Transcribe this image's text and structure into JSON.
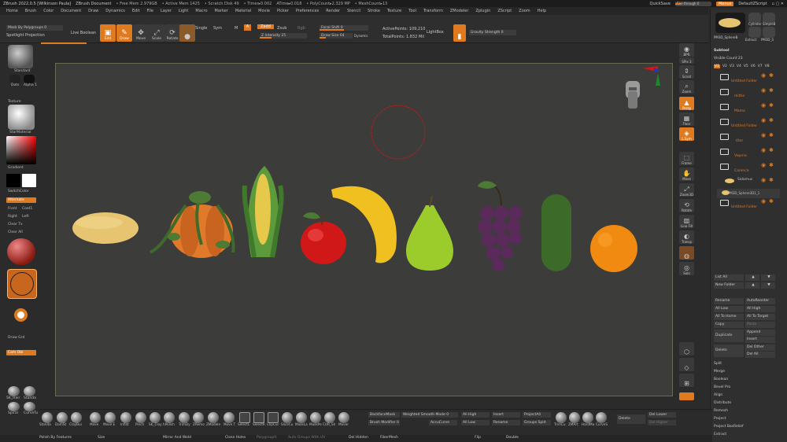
{
  "titlebar": {
    "app_title": "ZBrush 2022.0.5 [Wilkinson Paula]",
    "document": "ZBrush Document",
    "stats": [
      "• Free Mem 2.979GB",
      "• Active Mem 1425",
      "• Scratch Disk 49",
      "• Timer▸0.002",
      "ATime▸0.018",
      "• PolyCount▸2.329 MP",
      "• MeshCount▸13"
    ],
    "quicksave": "QuickSave",
    "see_through": "See-through 0",
    "menus": "Menus",
    "script": "DefaultZScript"
  },
  "menu": [
    "Home",
    "Brush",
    "Color",
    "Document",
    "Draw",
    "Dynamics",
    "Edit",
    "File",
    "Layer",
    "Light",
    "Macro",
    "Marker",
    "Material",
    "Movie",
    "Picker",
    "Preferences",
    "Render",
    "Stencil",
    "Stroke",
    "Texture",
    "Tool",
    "Transform",
    "ZModeler",
    "Zplugin",
    "ZScript",
    "Zoom",
    "Help"
  ],
  "toolbar": {
    "mask_by_polygroups": "Mask By Polygroups 0",
    "spotlight_projection": "Spotlight Projection",
    "live_boolean": "Live Boolean",
    "edit": "Edit",
    "draw": "Draw",
    "move": "Move",
    "scale": "Scale",
    "rotate": "Rotate",
    "single": "Single",
    "sym": "Sym",
    "m": "M",
    "zadd": "Zadd",
    "zsub": "Zsub",
    "rgb": "Rgb",
    "z_intensity": "Z Intensity 25",
    "focal_shift": "Focal Shift 0",
    "draw_size": "Draw Size 64",
    "dynamic": "Dynamic",
    "active_points": "ActivePoints: 109,210",
    "total_points": "TotalPoints: 1.832 Mil",
    "lightbox": "LightBox",
    "gravity_strength": "Gravity Strength 0"
  },
  "leftshelf": {
    "standard": "Standard",
    "dots": "Dots",
    "alpha": "Alpha 1",
    "texture": "Texture",
    "starmaterial": "StarMaterial",
    "gradient": "Gradient",
    "switch_color": "SwitchColor",
    "alternate": "Alternate",
    "front": "Front",
    "coat": "Coat1",
    "right": "Right",
    "left": "Left",
    "clear_tx": "Clear Tx",
    "clear_all": "Clear All",
    "draw_grid": "Draw Grd",
    "cam_obl": "Cam Obl",
    "brushes": [
      "SK_Hair",
      "Standa",
      "Spiral",
      "CurveTu"
    ]
  },
  "rightshelf": [
    "BPR",
    "SPix 3",
    "Scroll",
    "Zoom",
    "Actual",
    "AAHalf",
    "Persp",
    "Floor",
    "L.Sym",
    "Local",
    "Xyz",
    "Frame",
    "Move",
    "Zoom3D",
    "Rotate",
    "Line Fill",
    "Transp",
    "Ghost",
    "Solo"
  ],
  "panel": {
    "thumb_a": "PM3D_SphereB",
    "thumb_b": "Cylinder",
    "thumb_c": "SimpleB",
    "thumb_d": "Extract",
    "thumb_e": "PM3D_S",
    "subtool": "Subtool",
    "visible_count": "Visible Count 23",
    "v_tabs": [
      "V1",
      "V2",
      "V3",
      "V4",
      "V5",
      "V6",
      "V7",
      "V8"
    ],
    "items": [
      "Untitled Folder",
      "mittie",
      "Mama",
      "Untitled Folder",
      "titor",
      "Veprna",
      "Carenca",
      "Salamus",
      "PM3D_Sphere3D1_1",
      "Untitled Folder"
    ],
    "list_all": "List All",
    "new_folder": "New Folder",
    "rename": "Rename",
    "autoreorder": "AutoReorder",
    "all_low": "All Low",
    "all_high": "All High",
    "all_to_home": "All To Home",
    "all_to_target": "All To Target",
    "copy": "Copy",
    "paste": "Paste",
    "duplicate": "Duplicate",
    "append": "Append",
    "insert": "Insert",
    "delete": "Delete",
    "del_other": "Del Other",
    "del_all": "Del All",
    "sections": [
      "Split",
      "Merge",
      "Boolean",
      "Bevel Pro",
      "Align",
      "Distribute",
      "Remesh",
      "Project",
      "Project BasRelief",
      "Extract"
    ]
  },
  "bottombar": {
    "brushes": [
      "Standa",
      "DamSt",
      "ClayBui",
      "Move",
      "Move E",
      "hPolis",
      "Inflat",
      "Pinch",
      "SK_Cloy",
      "hPolish",
      "TrimDy",
      "ZRemo",
      "ZModele",
      "Move T",
      "SelectL",
      "SelectR",
      "ClipCur",
      "SliceCu",
      "MaskLa",
      "MaskPe",
      "CUR_Sh",
      "Mover"
    ],
    "backface_mask": "BackfaceMask",
    "weighted_smooth": "Weighted Smooth Mode 0",
    "brush_modifier": "Brush Modifier 0",
    "accucurve": "AccuCurve",
    "all_high": "All High",
    "all_low": "All Low",
    "insert": "Insert",
    "rename": "Rename",
    "project_all": "ProjectAll",
    "groups_split": "Groups Split",
    "brushes_right": [
      "TrimCu",
      "ZMArt",
      "HardMa",
      "CurveS"
    ],
    "delete": "Delete",
    "del_lower": "Del Lower",
    "del_higher": "Del Higher"
  },
  "statusbar": {
    "polish_by_features": "Polish By Features",
    "size": "Size",
    "mirror_and_weld": "Mirror And Weld",
    "close_holes": "Close Holes",
    "polygroupit": "PolygroupIt",
    "auto_groups": "Auto Groups With UV",
    "del_hidden": "Del Hidden",
    "fibermesh": "FiberMesh",
    "flip": "Flip",
    "double": "Double"
  },
  "colors": {
    "accent": "#e07a1f",
    "canvas": "#3c3c3a"
  }
}
